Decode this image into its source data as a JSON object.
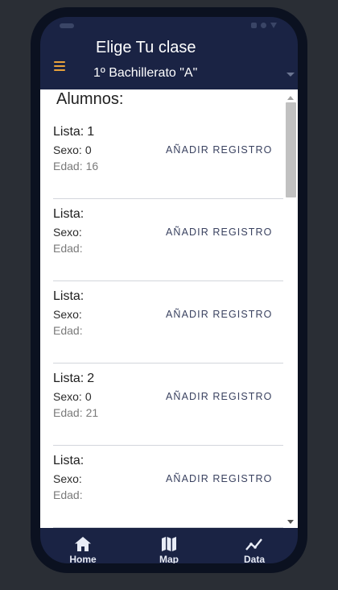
{
  "header": {
    "title": "Elige Tu clase",
    "selected_class": "1º Bachillerato \"A\""
  },
  "main": {
    "section_title": "Alumnos:",
    "add_label": "AÑADIR REGISTRO",
    "field_labels": {
      "lista": "Lista:",
      "sexo": "Sexo:",
      "edad": "Edad:"
    },
    "students": [
      {
        "lista": "1",
        "sexo": "0",
        "edad": "16"
      },
      {
        "lista": "",
        "sexo": "",
        "edad": ""
      },
      {
        "lista": "",
        "sexo": "",
        "edad": ""
      },
      {
        "lista": "2",
        "sexo": "0",
        "edad": "21"
      },
      {
        "lista": "",
        "sexo": "",
        "edad": ""
      }
    ]
  },
  "nav": {
    "items": [
      {
        "label": "Home",
        "icon": "home-icon"
      },
      {
        "label": "Map",
        "icon": "map-icon"
      },
      {
        "label": "Data",
        "icon": "chart-line-icon"
      }
    ]
  },
  "colors": {
    "header_bg": "#1a2344",
    "menu_accent": "#e9a23b",
    "frame": "#0b1120",
    "page_bg": "#2a2e35"
  }
}
